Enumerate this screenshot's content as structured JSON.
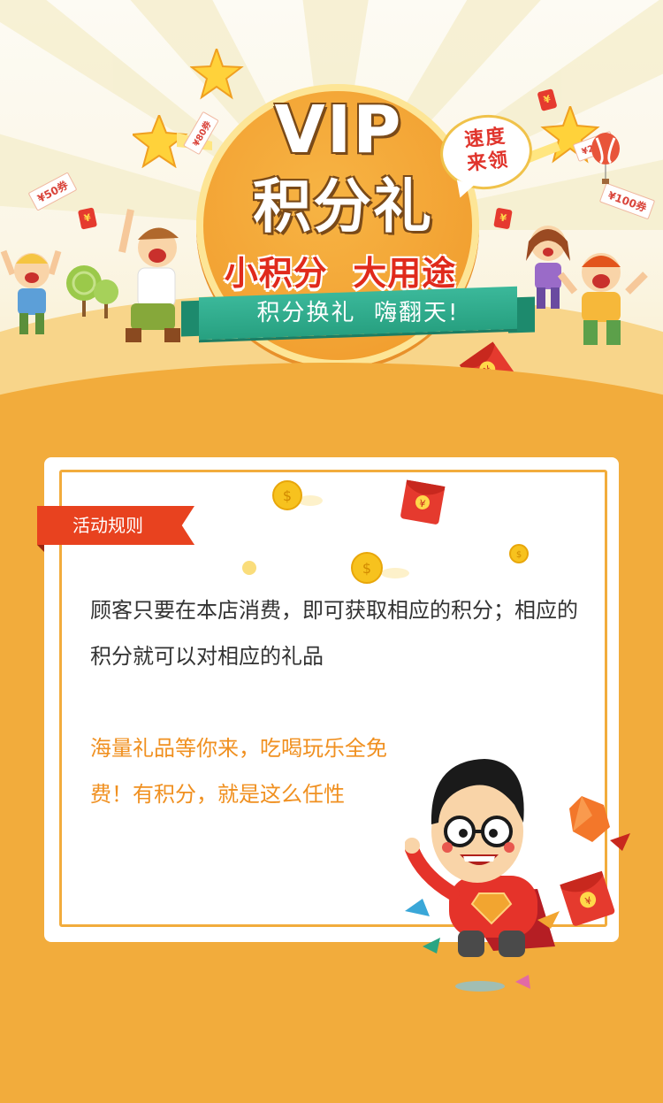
{
  "banner": {
    "title_top": "VIP",
    "title_main": "积分礼",
    "speech_line1": "速度",
    "speech_line2": "来领",
    "subtitle": "小积分  大用途",
    "ribbon_text": "积分换礼  嗨翻天!",
    "coupons": [
      "¥50券",
      "¥100券",
      "¥20券",
      "¥80券"
    ],
    "envelope_symbol": "¥"
  },
  "rules": {
    "tag_label": "活动规则",
    "description": "顾客只要在本店消费，即可获取相应的积分；相应的积分就可以对相应的礼品",
    "highlight": "海量礼品等你来，吃喝玩乐全免费！有积分，就是这么任性"
  },
  "colors": {
    "accent_orange": "#f2ac3c",
    "tag_red": "#e8421f",
    "ribbon_green": "#2aa583",
    "highlight_text": "#f09020"
  },
  "icons": [
    "star-icon",
    "coin-icon",
    "red-envelope-icon",
    "gem-icon",
    "balloon-icon"
  ]
}
